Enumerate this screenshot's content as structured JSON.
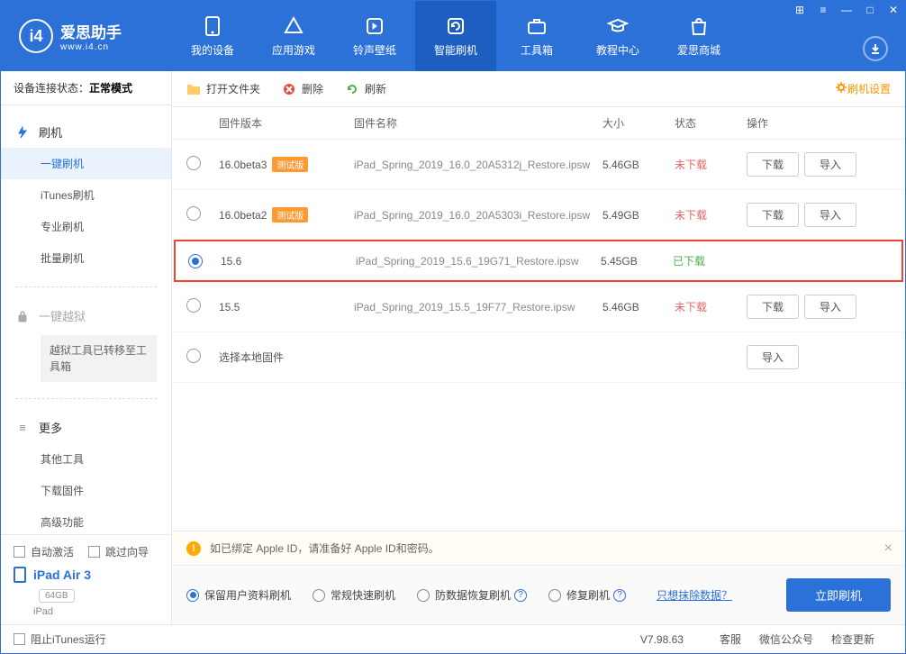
{
  "app": {
    "name": "爱思助手",
    "site": "www.i4.cn"
  },
  "nav": [
    {
      "label": "我的设备"
    },
    {
      "label": "应用游戏"
    },
    {
      "label": "铃声壁纸"
    },
    {
      "label": "智能刷机",
      "active": true
    },
    {
      "label": "工具箱"
    },
    {
      "label": "教程中心"
    },
    {
      "label": "爱思商城"
    }
  ],
  "sidebar": {
    "status_label": "设备连接状态：",
    "status_value": "正常模式",
    "groups": {
      "flash_label": "刷机",
      "flash_items": [
        "一键刷机",
        "iTunes刷机",
        "专业刷机",
        "批量刷机"
      ],
      "jailbreak_label": "一键越狱",
      "jailbreak_notice": "越狱工具已转移至工具箱",
      "more_label": "更多",
      "more_items": [
        "其他工具",
        "下载固件",
        "高级功能"
      ]
    },
    "bottom": {
      "auto_activate": "自动激活",
      "skip_guide": "跳过向导",
      "device_name": "iPad Air 3",
      "storage": "64GB",
      "device_type": "iPad"
    }
  },
  "toolbar": {
    "open_folder": "打开文件夹",
    "delete": "删除",
    "refresh": "刷新",
    "settings": "刷机设置"
  },
  "table": {
    "headers": {
      "version": "固件版本",
      "name": "固件名称",
      "size": "大小",
      "status": "状态",
      "action": "操作"
    },
    "rows": [
      {
        "version": "16.0beta3",
        "beta": "测试版",
        "name": "iPad_Spring_2019_16.0_20A5312j_Restore.ipsw",
        "size": "5.46GB",
        "status": "未下载",
        "download": "下载",
        "import": "导入",
        "checked": false
      },
      {
        "version": "16.0beta2",
        "beta": "测试版",
        "name": "iPad_Spring_2019_16.0_20A5303i_Restore.ipsw",
        "size": "5.49GB",
        "status": "未下载",
        "download": "下载",
        "import": "导入",
        "checked": false
      },
      {
        "version": "15.6",
        "beta": "",
        "name": "iPad_Spring_2019_15.6_19G71_Restore.ipsw",
        "size": "5.45GB",
        "status": "已下载",
        "download": "",
        "import": "",
        "checked": true,
        "highlight": true
      },
      {
        "version": "15.5",
        "beta": "",
        "name": "iPad_Spring_2019_15.5_19F77_Restore.ipsw",
        "size": "5.46GB",
        "status": "未下载",
        "download": "下载",
        "import": "导入",
        "checked": false
      }
    ],
    "local_firmware": "选择本地固件",
    "import_label": "导入"
  },
  "bottom": {
    "warning": "如已绑定 Apple ID，请准备好 Apple ID和密码。",
    "options": [
      "保留用户资料刷机",
      "常规快速刷机",
      "防数据恢复刷机",
      "修复刷机"
    ],
    "erase_link": "只想抹除数据？",
    "flash_now": "立即刷机"
  },
  "footer": {
    "block_itunes": "阻止iTunes运行",
    "version": "V7.98.63",
    "links": [
      "客服",
      "微信公众号",
      "检查更新"
    ]
  }
}
